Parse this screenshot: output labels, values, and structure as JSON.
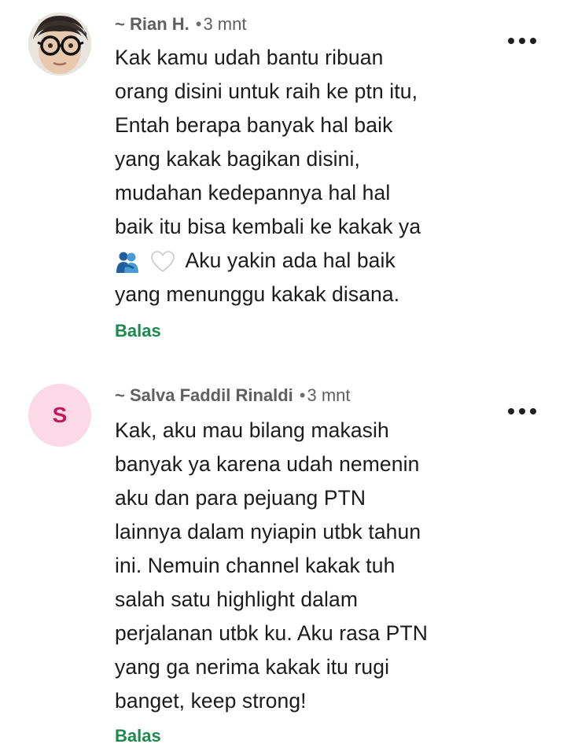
{
  "comments": [
    {
      "avatar_icon": "user-photo-avatar",
      "author": "~ Rian H.",
      "dot": "•",
      "time": "3 mnt",
      "more_icon": "more-options-icon",
      "lines": [
        "Kak kamu udah bantu ribuan",
        "orang disini untuk raih ke ptn itu,",
        "Entah berapa banyak hal baik",
        "yang kakak bagikan disini,",
        "mudahan kedepannya hal hal",
        "baik itu bisa kembali ke kakak ya"
      ],
      "emoji_line_text": "Aku yakin ada hal baik",
      "emoji_icons": [
        "hugging-people-emoji",
        "white-heart-emoji"
      ],
      "last_line": "yang menunggu kakak disana.",
      "reply_label": "Balas"
    },
    {
      "avatar_letter": "S",
      "avatar_color": "#fbd9e6",
      "author": "~ Salva Faddil Rinaldi",
      "dot": "•",
      "time": "3 mnt",
      "more_icon": "more-options-icon",
      "lines": [
        "Kak, aku mau bilang makasih",
        "banyak ya karena udah nemenin",
        "aku dan para pejuang PTN",
        "lainnya dalam nyiapin utbk tahun",
        "ini. Nemuin channel kakak tuh",
        "salah satu highlight dalam",
        "perjalanan utbk ku. Aku rasa PTN",
        "yang ga nerima kakak itu rugi",
        "banget, keep strong!"
      ],
      "reply_label": "Balas"
    }
  ],
  "colors": {
    "reply_green": "#1b8a4c",
    "meta_gray": "#5f5f5f",
    "text": "#1b1b1b"
  }
}
